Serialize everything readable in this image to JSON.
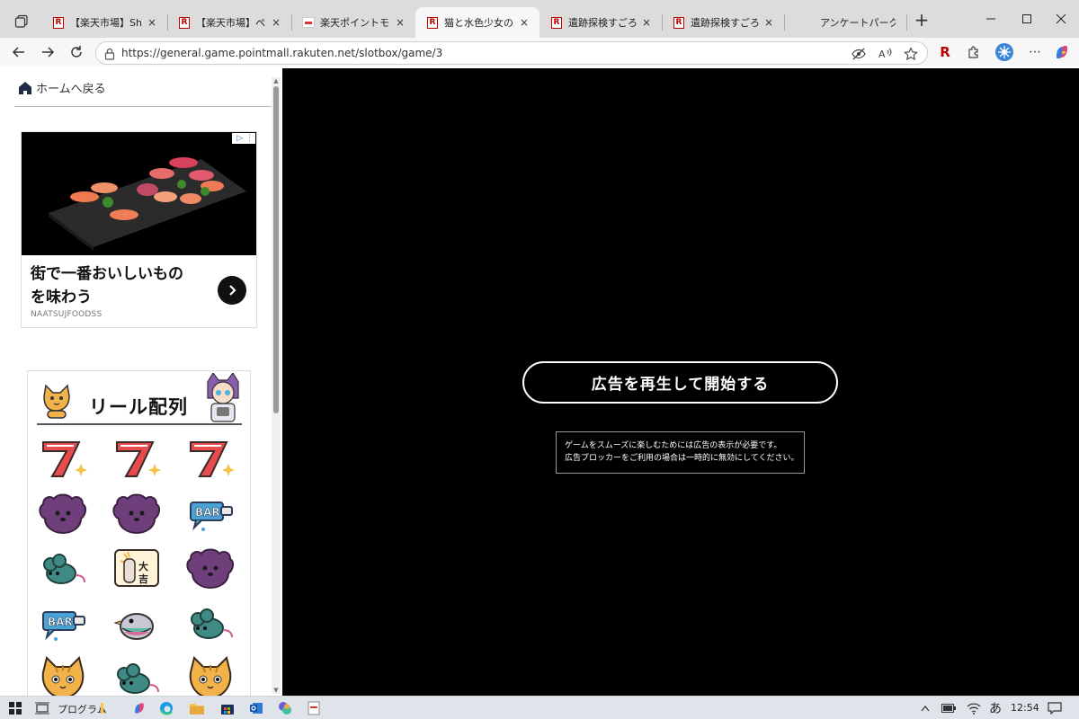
{
  "browser": {
    "tabs": [
      {
        "title": "【楽天市場】Shoppin",
        "favicon": "rakuten-r"
      },
      {
        "title": "【楽天市場】ページ割",
        "favicon": "rakuten-r"
      },
      {
        "title": "楽天ポイントモール |",
        "favicon": "pointmall"
      },
      {
        "title": "猫と水色少女の思い",
        "favicon": "rakuten-r",
        "active": true
      },
      {
        "title": "遺跡探検すごろく|",
        "favicon": "rakuten-r"
      },
      {
        "title": "遺跡探検すごろく|",
        "favicon": "rakuten-r"
      },
      {
        "title": "アンケートパーク",
        "favicon": "none"
      }
    ],
    "tab_close_glyph": "×",
    "new_tab_glyph": "+",
    "window_controls": [
      "minimize-icon",
      "maximize-icon",
      "close-icon"
    ],
    "url": "https://general.game.pointmall.rakuten.net/slotbox/game/3",
    "rakuten_ext_letter": "R"
  },
  "sidebar": {
    "home_link": "ホームへ戻る",
    "ad": {
      "headline_line1": "街で一番おいしいもの",
      "headline_line2": "を味わう",
      "brand": "NAATSUJFOODSS",
      "badge": "▷ ⋮"
    },
    "reel": {
      "title": "リール配列",
      "symbols": [
        [
          "seven",
          "seven",
          "seven"
        ],
        [
          "purple-dog",
          "purple-dog",
          "bar"
        ],
        [
          "mouse",
          "daikichi",
          "purple-dog"
        ],
        [
          "bar",
          "pigeon",
          "mouse"
        ],
        [
          "cat",
          "mouse",
          "cat"
        ]
      ]
    }
  },
  "game": {
    "start_button": "広告を再生して開始する",
    "notice_line1": "ゲームをスムーズに楽しむためには広告の表示が必要です。",
    "notice_line2": "広告ブロッカーをご利用の場合は一時的に無効にしてください。"
  },
  "taskbar": {
    "program_label": "プログラム",
    "ime_indicator": "あ",
    "clock": "12:54"
  },
  "colors": {
    "tabstrip": "#dcdcdc",
    "toolbar": "#f7f7f7",
    "game_bg": "#000000",
    "rakuten_red": "#bf0000",
    "taskbar": "#dfe3ea"
  }
}
